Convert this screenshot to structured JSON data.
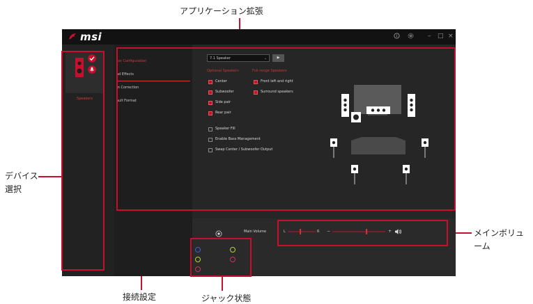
{
  "callouts": {
    "app_ext": "アプリケーション拡張",
    "device_select_1": "デバイス",
    "device_select_2": "選択",
    "main_volume_1": "メインボリュ",
    "main_volume_2": "ーム",
    "connection": "接続設定",
    "jack_status": "ジャック状態"
  },
  "app": {
    "logo": "msi",
    "device_label": "Speakers",
    "menu": [
      "ker Configuration",
      "nd Effects",
      "m Correction",
      "ault Format"
    ],
    "active_menu": 0,
    "speaker_select": "7.1 Speaker",
    "section_optional": "Optional Speakers",
    "section_fullrange": "Full-range Speakers",
    "optional_speakers": [
      {
        "label": "Center",
        "checked": true
      },
      {
        "label": "Subwoofer",
        "checked": true
      },
      {
        "label": "Side pair",
        "checked": true
      },
      {
        "label": "Rear pair",
        "checked": true
      }
    ],
    "fullrange_speakers": [
      {
        "label": "Front left and right",
        "checked": true
      },
      {
        "label": "Surround speakers",
        "checked": true
      }
    ],
    "options": [
      {
        "label": "Speaker Fill",
        "checked": false
      },
      {
        "label": "Enable Bass Management",
        "checked": false
      },
      {
        "label": "Swap Center / Subwoofer Output",
        "checked": false
      }
    ],
    "main_volume_label": "Main Volume",
    "balance_left": "L",
    "balance_right": "R",
    "volume_minus": "−",
    "volume_plus": "+",
    "balance_value": 0.45,
    "volume_value": 0.65
  },
  "colors": {
    "accent": "#c8102e",
    "jack_blue": "#3b62c8",
    "jack_green": "#b5d336",
    "jack_pink": "#c0365a",
    "jack_gray": "#7a7a7a"
  },
  "icons": {
    "info": "info-icon",
    "settings": "gear-icon",
    "minimize": "minimize-icon",
    "maximize": "maximize-icon",
    "close": "close-icon",
    "speaker_volume": "speaker-volume-icon",
    "connection_settings": "gear-icon"
  }
}
